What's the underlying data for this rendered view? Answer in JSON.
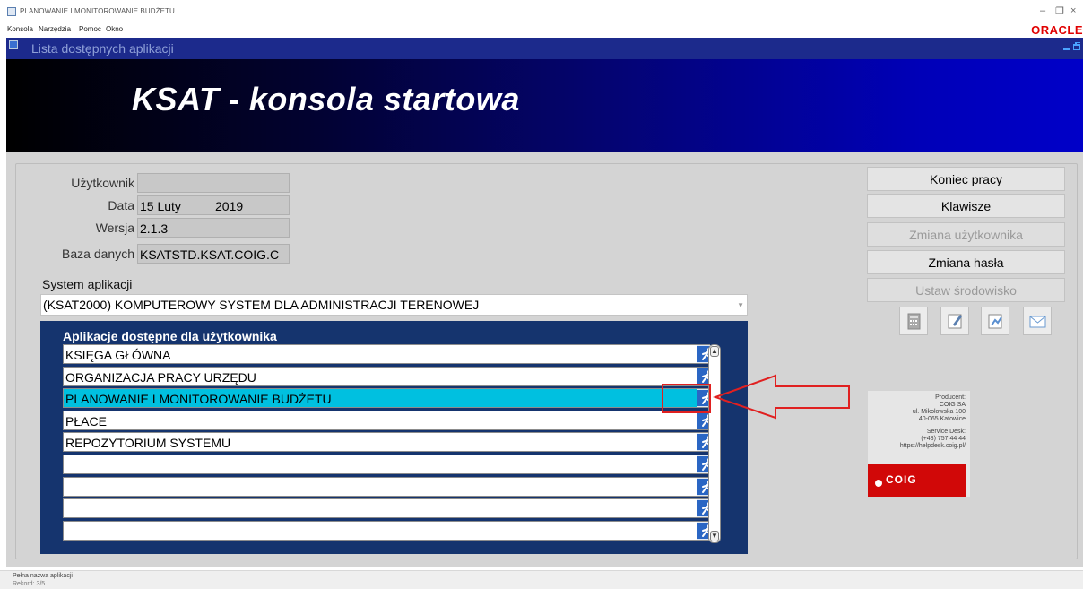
{
  "window": {
    "title": "PLANOWANIE I MONITOROWANIE BUDŻETU",
    "controls": [
      "–",
      "❐",
      "×"
    ],
    "brand": "ORACLE"
  },
  "menu": [
    "Konsola",
    "Narzędzia",
    "Pomoc",
    "Okno"
  ],
  "inner_window": {
    "title": "Lista dostępnych aplikacji"
  },
  "banner": {
    "title": "KSAT - konsola startowa"
  },
  "form": {
    "user_label": "Użytkownik",
    "user_value": "",
    "date_label": "Data",
    "date_day": "15 Luty",
    "date_year": "2019",
    "version_label": "Wersja",
    "version_value": "2.1.3",
    "db_label": "Baza danych",
    "db_value": "KSATSTD.KSAT.COIG.C"
  },
  "system": {
    "label": "System aplikacji",
    "selected": "(KSAT2000) KOMPUTEROWY SYSTEM DLA ADMINISTRACJI TERENOWEJ"
  },
  "apps": {
    "title": "Aplikacje dostępne dla użytkownika",
    "rows": [
      "KSIĘGA GŁÓWNA",
      "ORGANIZACJA PRACY URZĘDU",
      "PLANOWANIE I MONITOROWANIE BUDŻETU",
      "PŁACE",
      "REPOZYTORIUM SYSTEMU",
      "",
      "",
      "",
      ""
    ],
    "selected_index": 2
  },
  "buttons": {
    "end_work": "Koniec pracy",
    "keys": "Klawisze",
    "change_user": "Zmiana użytkownika",
    "change_password": "Zmiana hasła",
    "set_env": "Ustaw środowisko"
  },
  "tool_icons": [
    "calculator-icon",
    "notepad-icon",
    "chart-icon",
    "mail-icon"
  ],
  "producer": {
    "line1": "Producent:",
    "line2": "COIG SA",
    "line3": "ul. Mikołowska 100",
    "line4": "40-065 Katowice",
    "line5": "Service Desk:",
    "line6": "(+48) 757 44 44",
    "line7": "https://helpdesk.coig.pl/",
    "logo": "COIG"
  },
  "status": {
    "text": "Pełna nazwa aplikacji",
    "record": "Rekord: 3/5"
  },
  "colors": {
    "inner_titlebar": "#1c2a8c",
    "apps_panel": "#15346e",
    "selected_row": "#00c0e0",
    "annotation": "#e02020",
    "brand": "#e10000"
  }
}
